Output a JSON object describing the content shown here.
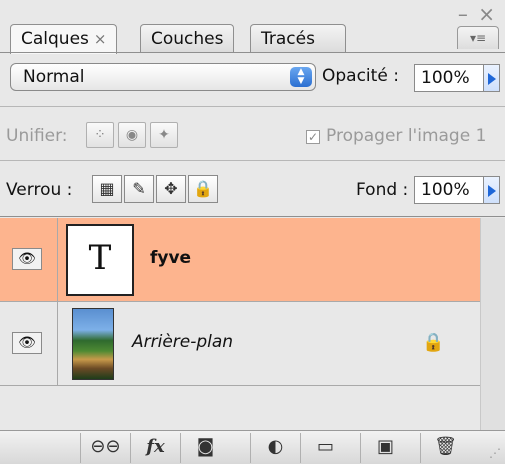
{
  "window": {
    "controls": "– ×"
  },
  "tabs": [
    {
      "label": "Calques",
      "close": "×"
    },
    {
      "label": "Couches"
    },
    {
      "label": "Tracés"
    }
  ],
  "panel_menu": "▾≡",
  "blend": {
    "mode": "Normal",
    "opacity_label": "Opacité :",
    "opacity_value": "100%"
  },
  "unify": {
    "label": "Unifier:",
    "propagate_label": "Propager l'image 1",
    "propagate_checked": true
  },
  "lock": {
    "label": "Verrou :",
    "fill_label": "Fond :",
    "fill_value": "100%"
  },
  "layers": [
    {
      "name": "fyve",
      "type": "text",
      "thumb_glyph": "T",
      "selected": true
    },
    {
      "name": "Arrière-plan",
      "type": "image",
      "locked": true,
      "selected": false
    }
  ],
  "icons": {
    "eye": "eye-icon",
    "lock": "lock-icon",
    "fx": "fx"
  },
  "colors": {
    "selected_row": "#fdb48e",
    "accent_blue": "#1f67d8"
  }
}
